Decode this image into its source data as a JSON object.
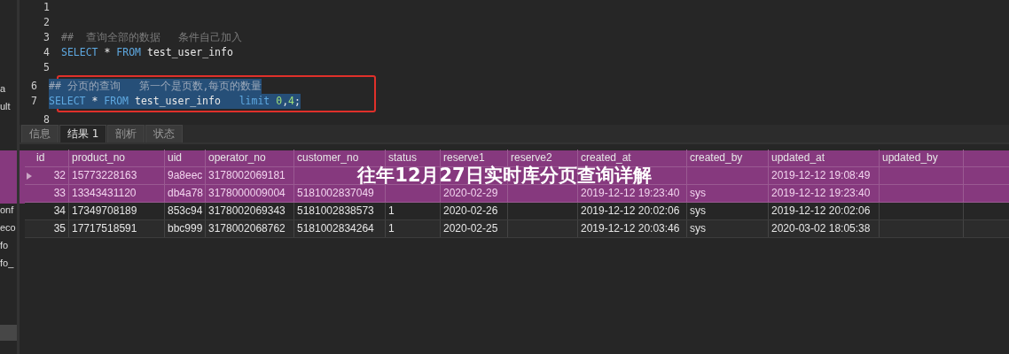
{
  "sidebar": {
    "items": [
      "a",
      "ult",
      "onf",
      "eco",
      "fo",
      "fo_"
    ]
  },
  "editor": {
    "lines": [
      {
        "number": "1",
        "selected": false
      },
      {
        "number": "2",
        "selected": false
      },
      {
        "number": "3",
        "selected": false,
        "tokens": [
          {
            "kind": "comment",
            "text": "##  查询全部的数据   条件自己加入"
          }
        ]
      },
      {
        "number": "4",
        "selected": false,
        "tokens": [
          {
            "kind": "keyword",
            "text": "SELECT"
          },
          {
            "kind": "plain",
            "text": " * "
          },
          {
            "kind": "keyword",
            "text": "FROM"
          },
          {
            "kind": "plain",
            "text": " test_user_info"
          }
        ]
      },
      {
        "number": "5",
        "selected": false
      },
      {
        "number": "6",
        "selected": true,
        "tokens": [
          {
            "kind": "comment",
            "text": "## 分页的查询   第一个是页数,每页的数量"
          }
        ]
      },
      {
        "number": "7",
        "selected": true,
        "tokens": [
          {
            "kind": "keyword",
            "text": "SELECT"
          },
          {
            "kind": "plain",
            "text": " * "
          },
          {
            "kind": "keyword",
            "text": "FROM"
          },
          {
            "kind": "plain",
            "text": " test_user_info   "
          },
          {
            "kind": "keyword",
            "text": "limit "
          },
          {
            "kind": "number",
            "text": "0"
          },
          {
            "kind": "plain",
            "text": ","
          },
          {
            "kind": "number",
            "text": "4"
          },
          {
            "kind": "plain",
            "text": ";"
          }
        ]
      },
      {
        "number": "8",
        "selected": false
      }
    ]
  },
  "tabs": [
    {
      "label": "信息",
      "selected": false
    },
    {
      "label": "结果 1",
      "selected": true
    },
    {
      "label": "剖析",
      "selected": false
    },
    {
      "label": "状态",
      "selected": false
    }
  ],
  "table": {
    "columns": [
      "id",
      "product_no",
      "uid",
      "operator_no",
      "customer_no",
      "status",
      "reserve1",
      "reserve2",
      "created_at",
      "created_by",
      "updated_at",
      "updated_by"
    ],
    "rows": [
      {
        "selected": true,
        "cells": [
          "32",
          "15773228163",
          "9a8eec",
          "3178002069181",
          null,
          null,
          null,
          null,
          null,
          null,
          "2019-12-12 19:08:49",
          null
        ]
      },
      {
        "selected": false,
        "cells": [
          "33",
          "13343431120",
          "db4a78",
          "3178000009004",
          "5181002837049",
          null,
          "2020-02-29",
          null,
          "2019-12-12 19:23:40",
          "sys",
          "2019-12-12 19:23:40",
          null
        ]
      },
      {
        "selected": false,
        "cells": [
          "34",
          "17349708189",
          "853c94",
          "3178002069343",
          "5181002838573",
          "1",
          "2020-02-26",
          null,
          "2019-12-12 20:02:06",
          "sys",
          "2019-12-12 20:02:06",
          null
        ]
      },
      {
        "selected": false,
        "cells": [
          "35",
          "17717518591",
          "bbc999",
          "3178002068762",
          "5181002834264",
          "1",
          "2020-02-25",
          null,
          "2019-12-12 20:03:46",
          "sys",
          "2020-03-02 18:05:38",
          null
        ]
      }
    ]
  },
  "banner": {
    "title": "往年12月27日实时库分页查询详解"
  }
}
